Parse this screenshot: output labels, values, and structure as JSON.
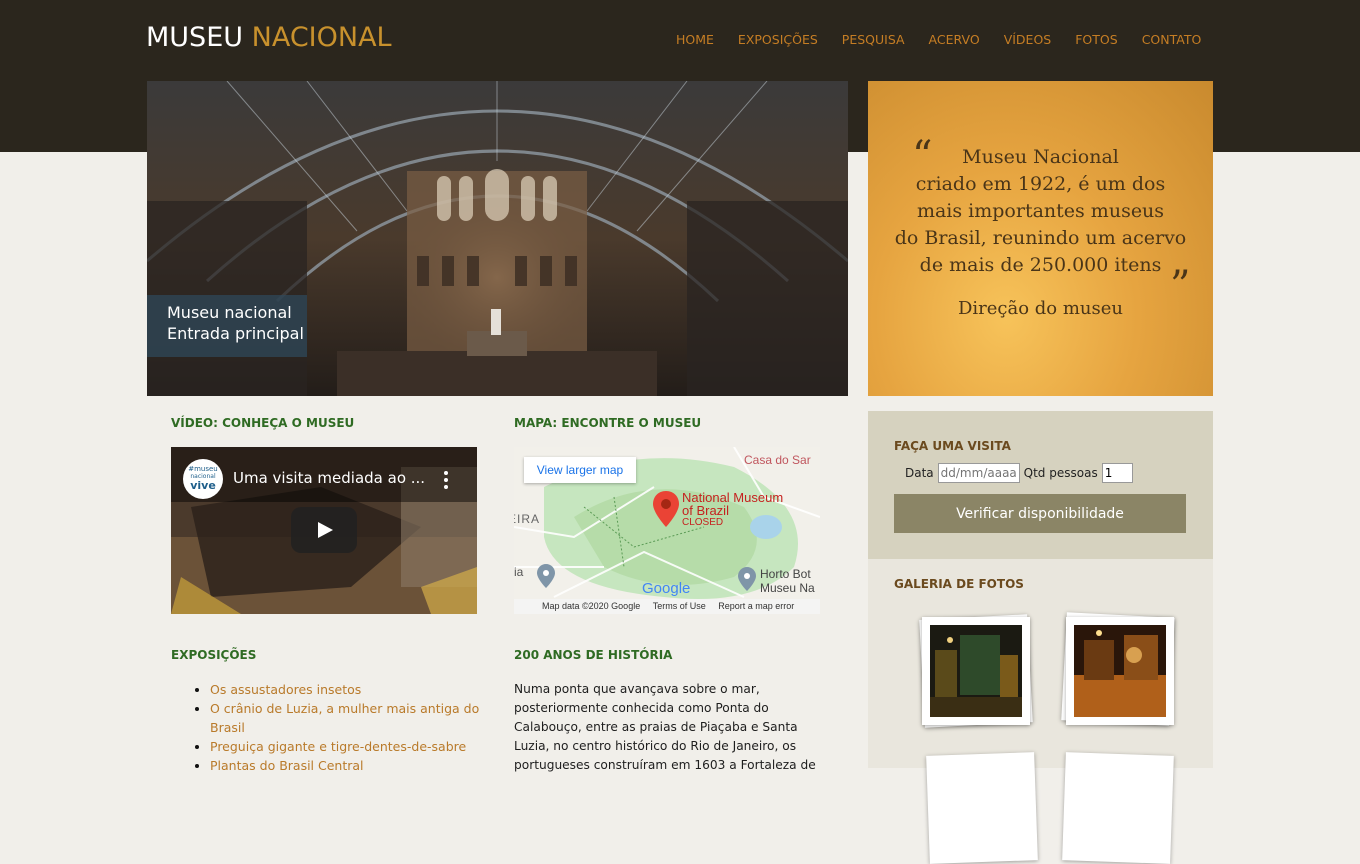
{
  "header": {
    "logo_main": "MUSEU",
    "logo_accent": "NACIONAL",
    "nav": [
      "HOME",
      "EXPOSIÇÕES",
      "PESQUISA",
      "ACERVO",
      "VÍDEOS",
      "FOTOS",
      "CONTATO"
    ]
  },
  "hero": {
    "caption_line1": "Museu nacional",
    "caption_line2": "Entrada principal"
  },
  "quote": {
    "lines": [
      "Museu Nacional",
      "criado em 1922, é um dos",
      "mais importantes museus",
      "do Brasil, reunindo um acervo",
      "de mais de 250.000 itens"
    ],
    "open_mark": "“",
    "close_mark": "”",
    "signature": "Direção do museu"
  },
  "video": {
    "section_title": "VÍDEO: CONHEÇA O MUSEU",
    "title": "Uma visita mediada ao ...",
    "channel_logo_line1": "#museu",
    "channel_logo_line2": "nacional",
    "channel_logo_line3": "vive"
  },
  "map": {
    "section_title": "MAPA: ENCONTRE O MUSEU",
    "view_larger": "View larger map",
    "place_name_line1": "National Museum",
    "place_name_line2": "of Brazil",
    "place_status": "CLOSED",
    "label_casa": "Casa do Sar",
    "label_ira": "EIRA",
    "label_horto1": "Horto Bot",
    "label_horto2": "Museu Na",
    "label_ia": "ia",
    "google": "Google",
    "footer_data": "Map data ©2020 Google",
    "footer_terms": "Terms of Use",
    "footer_report": "Report a map error"
  },
  "exhibitions": {
    "section_title": "EXPOSIÇÕES",
    "items": [
      "Os assustadores insetos",
      "O crânio de Luzia, a mulher mais antiga do Brasil",
      "Preguiça gigante e tigre-dentes-de-sabre",
      "Plantas do Brasil Central"
    ]
  },
  "history": {
    "section_title": "200 ANOS DE HISTÓRIA",
    "text": "Numa ponta que avançava sobre o mar, posteriormente conhecida como Ponta do Calabouço, entre as praias de Piaçaba e Santa Luzia, no centro histórico do Rio de Janeiro, os portugueses construíram em 1603 a Fortaleza de"
  },
  "visit": {
    "title": "FAÇA UMA VISITA",
    "date_label": "Data",
    "date_placeholder": "dd/mm/aaaa",
    "qty_label": "Qtd pessoas",
    "qty_value": "1",
    "button": "Verificar disponibilidade"
  },
  "gallery": {
    "title": "GALERIA DE FOTOS"
  },
  "colors": {
    "header_bg": "#2b261d",
    "accent": "#c8912d",
    "nav": "#c57d24",
    "section_title": "#2f6b23",
    "page_bg": "#f1efea",
    "button_bg": "#8b8566"
  }
}
